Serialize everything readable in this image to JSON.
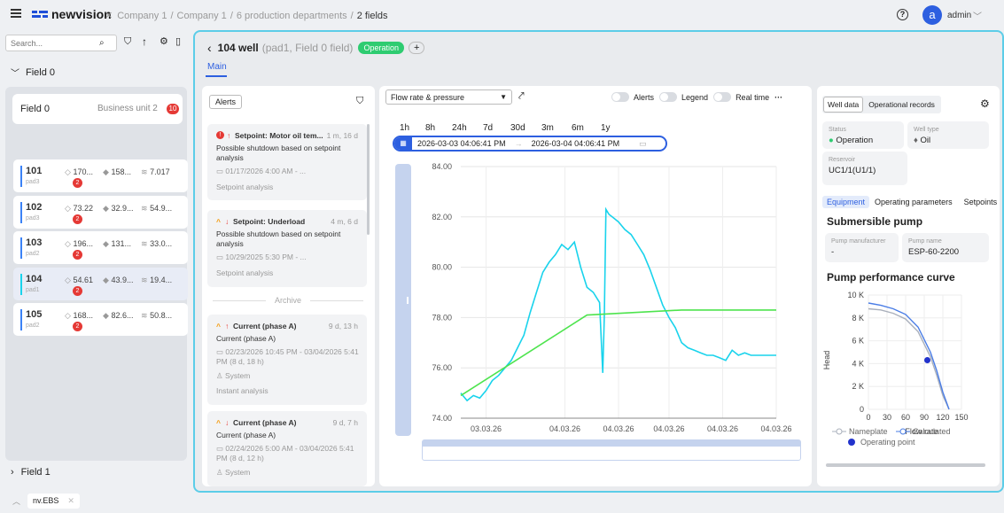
{
  "header": {
    "logo_text": "newvision",
    "breadcrumb": [
      "Company 1",
      "Company 1",
      "6 production departments",
      "2 fields"
    ],
    "user": "admin",
    "avatar_letter": "a"
  },
  "sidebar": {
    "search_placeholder": "Search...",
    "field0_label": "Field 0",
    "field_card": {
      "name": "Field 0",
      "unit": "Business unit 2",
      "badge": "10"
    },
    "wells": [
      {
        "id": "101",
        "pad": "pad3",
        "m1": "170...",
        "m2": "158...",
        "m3": "7.017",
        "badge": "2"
      },
      {
        "id": "102",
        "pad": "pad3",
        "m1": "73.22",
        "m2": "32.9...",
        "m3": "54.9...",
        "badge": "2"
      },
      {
        "id": "103",
        "pad": "pad2",
        "m1": "196...",
        "m2": "131...",
        "m3": "33.0...",
        "badge": "2"
      },
      {
        "id": "104",
        "pad": "pad1",
        "m1": "54.61",
        "m2": "43.9...",
        "m3": "19.4...",
        "badge": "2"
      },
      {
        "id": "105",
        "pad": "pad2",
        "m1": "168...",
        "m2": "82.6...",
        "m3": "50.8...",
        "badge": "2"
      }
    ],
    "field1_label": "Field 1"
  },
  "well": {
    "title": "104 well",
    "subtitle": "(pad1, Field 0 field)",
    "status": "Operation",
    "tab_main": "Main"
  },
  "alerts": {
    "header_label": "Alerts",
    "archive_label": "Archive",
    "items": [
      {
        "title": "Setpoint: Motor oil tem...",
        "ago": "1 m, 16 d",
        "desc": "Possible shutdown based on setpoint analysis",
        "time": "01/17/2026 4:00 AM - ...",
        "source": "Setpoint analysis"
      },
      {
        "title": "Setpoint: Underload",
        "ago": "4 m, 6 d",
        "desc": "Possible shutdown based on setpoint analysis",
        "time": "10/29/2025 5:30 PM - ...",
        "source": "Setpoint analysis"
      },
      {
        "title": "Current (phase A)",
        "ago": "9 d, 13 h",
        "desc": "Current (phase A)",
        "time": "02/23/2026 10:45 PM - 03/04/2026 5:41 PM (8 d, 18 h)",
        "user": "System",
        "source": "Instant analysis"
      },
      {
        "title": "Current (phase A)",
        "ago": "9 d, 7 h",
        "desc": "Current (phase A)",
        "time": "02/24/2026 5:00 AM - 03/04/2026 5:41 PM (8 d, 12 h)",
        "user": "System"
      }
    ]
  },
  "chart_panel": {
    "select_value": "Flow rate & pressure",
    "toggles": [
      "Alerts",
      "Legend",
      "Real time"
    ],
    "more": "···",
    "ranges": [
      "1h",
      "8h",
      "24h",
      "7d",
      "30d",
      "3m",
      "6m",
      "1y"
    ],
    "date_from": "2026-03-03 04:06:41 PM",
    "date_to": "2026-03-04 04:06:41 PM"
  },
  "chart_data": {
    "type": "line",
    "ylim": [
      74.0,
      84.0
    ],
    "yticks": [
      "84.00",
      "82.00",
      "80.00",
      "78.00",
      "76.00",
      "74.00"
    ],
    "xticks": [
      "03.03.26",
      "04.03.26",
      "04.03.26",
      "04.03.26",
      "04.03.26",
      "04.03.26"
    ],
    "series": [
      {
        "color": "#19d3ec",
        "x": [
          0,
          2,
          4,
          6,
          8,
          10,
          12,
          14,
          16,
          18,
          20,
          22,
          24,
          26,
          28,
          30,
          32,
          34,
          36,
          38,
          40,
          42,
          44,
          45,
          45.5,
          46,
          47,
          48,
          50,
          52,
          54,
          56,
          58,
          60,
          62,
          64,
          66,
          68,
          70,
          72,
          74,
          76,
          78,
          80,
          82,
          84,
          86,
          88,
          90,
          92,
          94,
          96,
          98,
          100
        ],
        "values": [
          75,
          74.7,
          74.9,
          74.8,
          75.1,
          75.5,
          75.7,
          76.0,
          76.3,
          76.8,
          77.3,
          78.2,
          79.0,
          79.8,
          80.2,
          80.5,
          80.9,
          80.7,
          81.0,
          80.0,
          79.2,
          79.0,
          78.6,
          75.8,
          78.1,
          82.3,
          82.1,
          82.0,
          81.8,
          81.5,
          81.3,
          80.9,
          80.5,
          79.9,
          79.2,
          78.5,
          78.0,
          77.6,
          77.0,
          76.8,
          76.7,
          76.6,
          76.5,
          76.5,
          76.4,
          76.3,
          76.7,
          76.5,
          76.6,
          76.5,
          76.5,
          76.5,
          76.5,
          76.5
        ]
      },
      {
        "color": "#4ee44e",
        "x": [
          0,
          40,
          70,
          100
        ],
        "values": [
          74.9,
          78.1,
          78.3,
          78.3
        ]
      }
    ]
  },
  "right_panel": {
    "tabs": [
      "Well data",
      "Operational records"
    ],
    "status_label": "Status",
    "status_value": "Operation",
    "welltype_label": "Well type",
    "welltype_value": "Oil",
    "reservoir_label": "Reservoir",
    "reservoir_value": "UC1/1(U1/1)",
    "subtabs": [
      "Equipment",
      "Operating parameters",
      "Setpoints"
    ],
    "pump_title": "Submersible pump",
    "manufacturer_label": "Pump manufacturer",
    "manufacturer_value": "-",
    "pumpname_label": "Pump name",
    "pumpname_value": "ESP-60-2200",
    "curve_title": "Pump performance curve"
  },
  "pump_chart": {
    "type": "line",
    "ylabel": "Head",
    "xlabel": "Flow rate",
    "xticks": [
      "0",
      "30",
      "60",
      "90",
      "120",
      "150"
    ],
    "yticks": [
      "10 K",
      "8 K",
      "6 K",
      "4 K",
      "2 K",
      "0"
    ],
    "legend": [
      "Nameplate",
      "Calculated",
      "Operating point"
    ],
    "series": [
      {
        "name": "Nameplate",
        "color": "#aab0bc",
        "x": [
          0,
          20,
          40,
          60,
          80,
          100,
          110,
          120,
          130
        ],
        "values": [
          8800,
          8700,
          8400,
          7900,
          6800,
          4600,
          3000,
          1200,
          0
        ]
      },
      {
        "name": "Calculated",
        "color": "#4a7de6",
        "x": [
          0,
          20,
          40,
          60,
          80,
          100,
          110,
          120,
          130
        ],
        "values": [
          9300,
          9100,
          8800,
          8300,
          7200,
          5000,
          3400,
          1500,
          0
        ]
      }
    ],
    "operating_point": {
      "x": 95,
      "y": 4300
    }
  },
  "footer": {
    "tab": "nv.EBS"
  }
}
